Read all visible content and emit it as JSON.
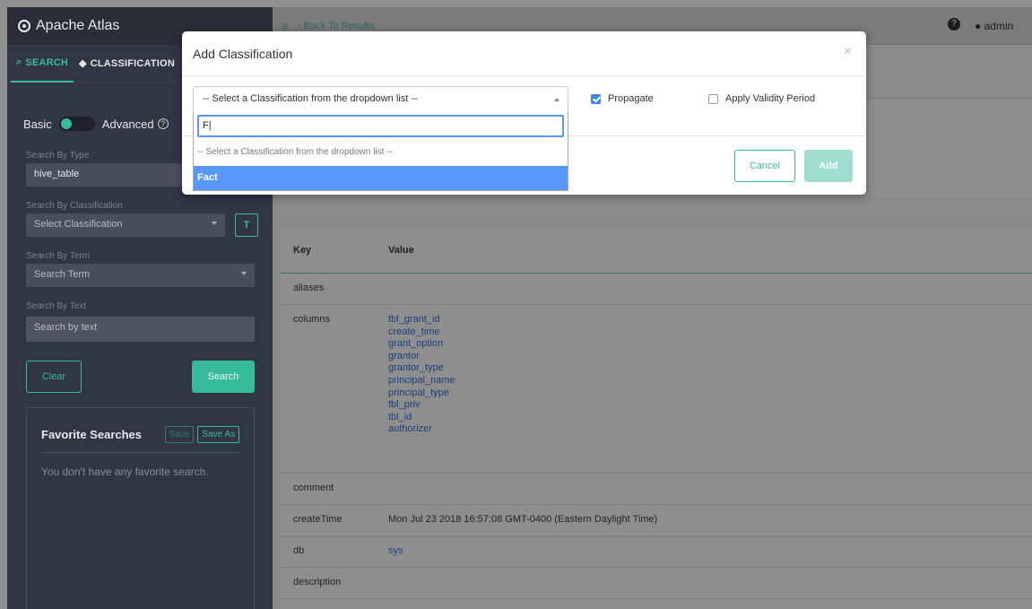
{
  "app": {
    "title": "Apache Atlas"
  },
  "sidebar": {
    "tabs": [
      {
        "label": "SEARCH",
        "icon": "search-icon"
      },
      {
        "label": "CLASSIFICATION",
        "icon": "tag-icon"
      }
    ],
    "toggle": {
      "left": "Basic",
      "right": "Advanced"
    },
    "type_label": "Search By Type",
    "type_value": "hive_table",
    "classification_label": "Search By Classification",
    "classification_value": "Select Classification",
    "term_label": "Search By Term",
    "term_value": "Search Term",
    "text_label": "Search By Text",
    "text_placeholder": "Search by text",
    "clear_label": "Clear",
    "search_label": "Search",
    "favorites": {
      "title": "Favorite Searches",
      "save_label": "Save",
      "save_as_label": "Save As",
      "empty_text": "You don't have any favorite search."
    }
  },
  "header": {
    "back_label": "Back To Results",
    "user": "admin"
  },
  "table": {
    "headers": {
      "key": "Key",
      "value": "Value"
    },
    "rows": [
      {
        "key": "aliases",
        "value": ""
      },
      {
        "key": "columns",
        "links": [
          "tbl_grant_id",
          "create_time",
          "grant_option",
          "grantor",
          "grantor_type",
          "principal_name",
          "principal_type",
          "tbl_priv",
          "tbl_id",
          "authorizer"
        ]
      },
      {
        "key": "comment",
        "value": ""
      },
      {
        "key": "createTime",
        "value": "Mon Jul 23 2018 16:57:08 GMT-0400 (Eastern Daylight Time)"
      },
      {
        "key": "db",
        "link": "sys"
      },
      {
        "key": "description",
        "value": ""
      }
    ]
  },
  "modal": {
    "title": "Add Classification",
    "close_glyph": "×",
    "select_value": "-- Select a Classification from the dropdown list --",
    "propagate_label": "Propagate",
    "validity_label": "Apply Validity Period",
    "cancel_label": "Cancel",
    "add_label": "Add"
  },
  "dropdown": {
    "search_value": "F",
    "options": [
      "-- Select a Classification from the dropdown list --",
      "Fact"
    ]
  }
}
